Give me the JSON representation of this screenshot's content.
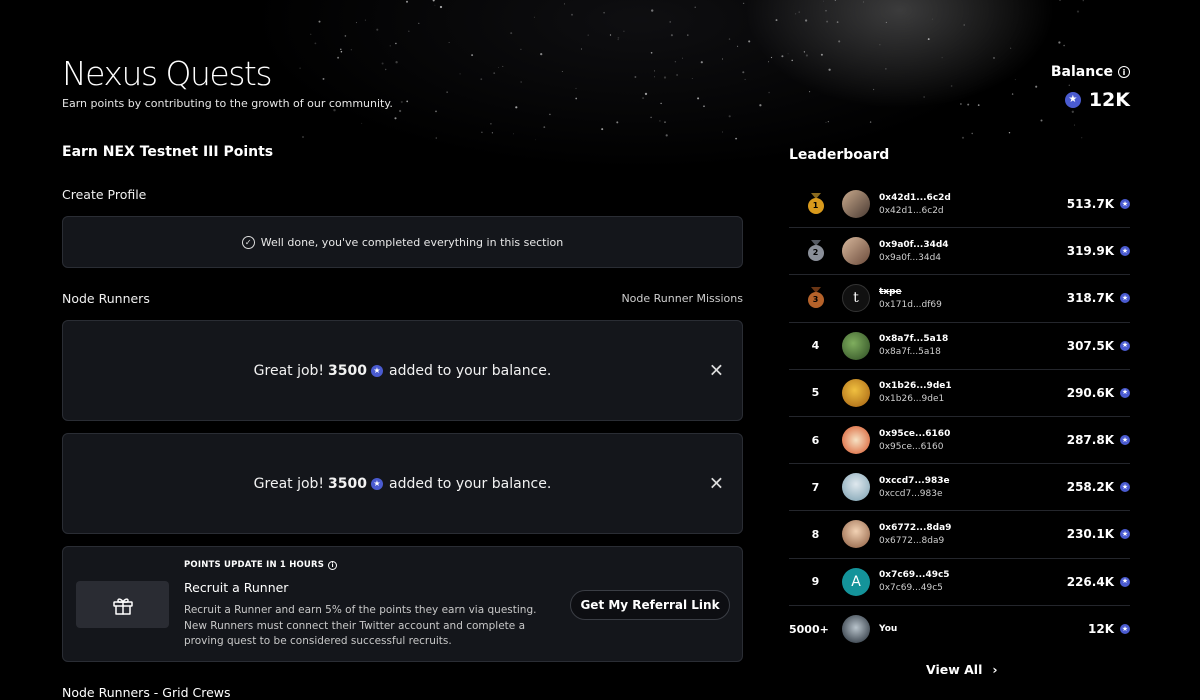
{
  "header": {
    "title": "Nexus Quests",
    "subtitle": "Earn points by contributing to the growth of our community."
  },
  "balance": {
    "label": "Balance",
    "value": "12K"
  },
  "earn": {
    "title": "Earn NEX Testnet III Points",
    "create_profile": {
      "title": "Create Profile",
      "done_message": "Well done, you've completed everything in this section"
    },
    "node_runners": {
      "title": "Node Runners",
      "missions_link": "Node Runner Missions",
      "notices": [
        {
          "prefix": "Great job!",
          "amount": "3500",
          "suffix": "added to your balance."
        },
        {
          "prefix": "Great job!",
          "amount": "3500",
          "suffix": "added to your balance."
        }
      ],
      "recruit": {
        "update": "POINTS UPDATE IN 1 HOURS",
        "title": "Recruit a Runner",
        "description": "Recruit a Runner and earn 5% of the points they earn via questing. New Runners must connect their Twitter account and complete a proving quest to be considered successful recruits.",
        "button": "Get My Referral Link"
      }
    },
    "grid_crews_title": "Node Runners - Grid Crews"
  },
  "leaderboard": {
    "title": "Leaderboard",
    "rows": [
      {
        "rank": "1",
        "name": "0x42d1...6c2d",
        "addr": "0x42d1...6c2d",
        "points": "513.7K"
      },
      {
        "rank": "2",
        "name": "0x9a0f...34d4",
        "addr": "0x9a0f...34d4",
        "points": "319.9K"
      },
      {
        "rank": "3",
        "name": "txpe",
        "addr": "0x171d...df69",
        "points": "318.7K",
        "avatar_letter": "t"
      },
      {
        "rank": "4",
        "name": "0x8a7f...5a18",
        "addr": "0x8a7f...5a18",
        "points": "307.5K"
      },
      {
        "rank": "5",
        "name": "0x1b26...9de1",
        "addr": "0x1b26...9de1",
        "points": "290.6K"
      },
      {
        "rank": "6",
        "name": "0x95ce...6160",
        "addr": "0x95ce...6160",
        "points": "287.8K"
      },
      {
        "rank": "7",
        "name": "0xccd7...983e",
        "addr": "0xccd7...983e",
        "points": "258.2K"
      },
      {
        "rank": "8",
        "name": "0x6772...8da9",
        "addr": "0x6772...8da9",
        "points": "230.1K"
      },
      {
        "rank": "9",
        "name": "0x7c69...49c5",
        "addr": "0x7c69...49c5",
        "points": "226.4K",
        "avatar_letter": "A"
      }
    ],
    "you": {
      "rank": "5000+",
      "name": "You",
      "points": "12K"
    },
    "view_all": "View All"
  },
  "colors": {
    "background": "#000000",
    "card": "#14161b",
    "coin": "#4a5bd0",
    "gold": "#d99a1c",
    "silver": "#8a8f99",
    "bronze": "#b5622a"
  },
  "icons": {
    "coin": "star-coin-icon",
    "info": "info-icon",
    "check": "check-circle-icon",
    "close": "close-icon",
    "gift": "gift-icon",
    "chevron": "chevron-right-icon",
    "medal": "medal-icon"
  }
}
